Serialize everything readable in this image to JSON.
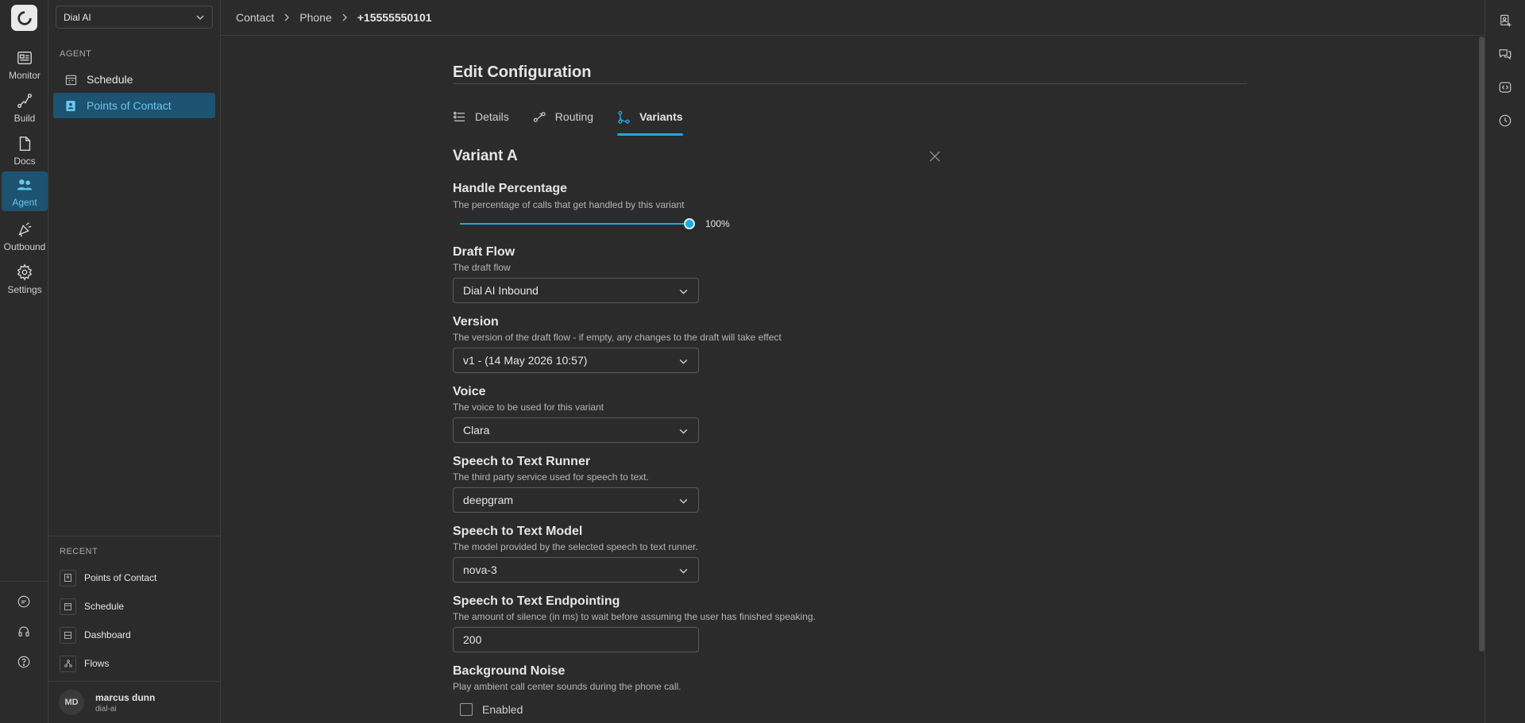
{
  "org_select": {
    "value": "Dial AI"
  },
  "rail": {
    "items": [
      {
        "label": "Monitor",
        "icon": "monitor-icon"
      },
      {
        "label": "Build",
        "icon": "build-icon"
      },
      {
        "label": "Docs",
        "icon": "docs-icon"
      },
      {
        "label": "Agent",
        "icon": "agent-icon"
      },
      {
        "label": "Outbound",
        "icon": "outbound-icon"
      },
      {
        "label": "Settings",
        "icon": "gear-icon"
      }
    ],
    "active": "Agent"
  },
  "panel": {
    "section_title": "AGENT",
    "items": [
      {
        "label": "Schedule",
        "icon": "calendar-icon"
      },
      {
        "label": "Points of Contact",
        "icon": "contact-icon"
      }
    ],
    "recent_title": "RECENT",
    "recent": [
      {
        "label": "Points of Contact"
      },
      {
        "label": "Schedule"
      },
      {
        "label": "Dashboard"
      },
      {
        "label": "Flows"
      }
    ]
  },
  "user": {
    "initials": "MD",
    "name": "marcus dunn",
    "org": "dial-ai"
  },
  "breadcrumb": [
    "Contact",
    "Phone",
    "+15555550101"
  ],
  "main": {
    "title": "Edit Configuration",
    "tabs": [
      {
        "label": "Details"
      },
      {
        "label": "Routing"
      },
      {
        "label": "Variants"
      }
    ],
    "active_tab": "Variants",
    "variant_title": "Variant A",
    "handle": {
      "label": "Handle Percentage",
      "desc": "The percentage of calls that get handled by this variant",
      "value_text": "100%",
      "value": 100
    },
    "draft_flow": {
      "label": "Draft Flow",
      "desc": "The draft flow",
      "value": "Dial AI Inbound"
    },
    "version": {
      "label": "Version",
      "desc": "The version of the draft flow - if empty, any changes to the draft will take effect",
      "value": "v1 - (14 May 2026 10:57)"
    },
    "voice": {
      "label": "Voice",
      "desc": "The voice to be used for this variant",
      "value": "Clara"
    },
    "stt_runner": {
      "label": "Speech to Text Runner",
      "desc": "The third party service used for speech to text.",
      "value": "deepgram"
    },
    "stt_model": {
      "label": "Speech to Text Model",
      "desc": "The model provided by the selected speech to text runner.",
      "value": "nova-3"
    },
    "stt_endpointing": {
      "label": "Speech to Text Endpointing",
      "desc": "The amount of silence (in ms) to wait before assuming the user has finished speaking.",
      "value": "200"
    },
    "background_noise": {
      "label": "Background Noise",
      "desc": "Play ambient call center sounds during the phone call.",
      "checkbox_label": "Enabled",
      "checked": false
    }
  },
  "colors": {
    "accent": "#23a7e0",
    "active_bg": "#1d5270",
    "bg": "#2b2b2b"
  }
}
